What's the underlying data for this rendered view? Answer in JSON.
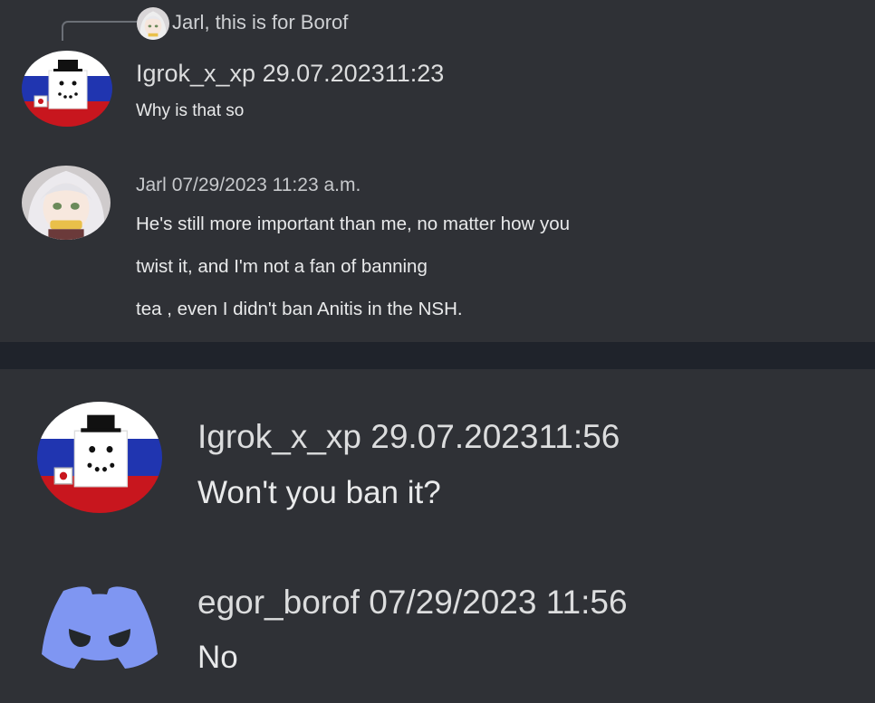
{
  "reply": {
    "text": "Jarl, this is for Borof",
    "avatar_icon": "anime-girl-avatar-icon"
  },
  "messages": [
    {
      "author": "Igrok_x_xp",
      "timestamp": "29.07.202311:23",
      "avatar_icon": "snowman-russian-flag-avatar-icon",
      "lines": [
        "Why is that so"
      ]
    },
    {
      "author": "Jarl",
      "timestamp": "07/29/2023 11:23 a.m.",
      "avatar_icon": "anime-girl-avatar-icon",
      "lines": [
        "He's still more important than me, no matter how you",
        "twist it, and I'm not a fan of banning",
        "tea , even I didn't ban Anitis in the NSH."
      ]
    },
    {
      "author": "Igrok_x_xp",
      "timestamp": "29.07.202311:56",
      "avatar_icon": "snowman-russian-flag-avatar-icon",
      "lines": [
        "Won't you ban it?"
      ]
    },
    {
      "author": "egor_borof",
      "timestamp": "07/29/2023 11:56",
      "avatar_icon": "discord-logo-avatar-icon",
      "lines": [
        "No"
      ]
    }
  ],
  "colors": {
    "background": "#2f3136",
    "divider": "#1f232b",
    "discord_blurple": "#7f96f2",
    "flag_white": "#ffffff",
    "flag_blue": "#2035b0",
    "flag_red": "#c8161e"
  }
}
